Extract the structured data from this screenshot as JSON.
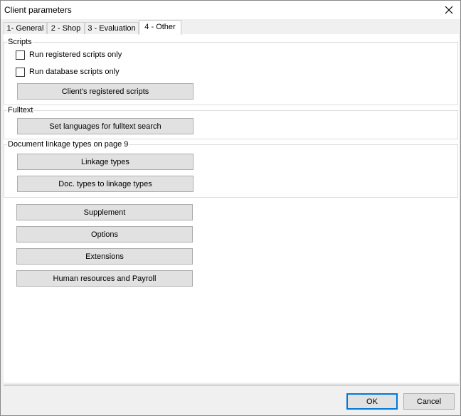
{
  "window": {
    "title": "Client parameters"
  },
  "tabs": [
    {
      "label": "1- General"
    },
    {
      "label": "2 - Shop"
    },
    {
      "label": "3 - Evaluation"
    },
    {
      "label": "4 - Other"
    }
  ],
  "active_tab": "4 - Other",
  "scripts": {
    "label": "Scripts",
    "run_registered_only": {
      "label": "Run registered scripts only",
      "checked": false
    },
    "run_database_only": {
      "label": "Run database scripts only",
      "checked": false
    },
    "registered_scripts_button": "Client's registered scripts"
  },
  "fulltext": {
    "label": "Fulltext",
    "set_languages_button": "Set languages for fulltext search"
  },
  "linkage": {
    "label": "Document linkage types on page 9",
    "linkage_types_button": "Linkage types",
    "doc_types_button": "Doc. types to linkage types"
  },
  "other_buttons": {
    "supplement": "Supplement",
    "options": "Options",
    "extensions": "Extensions",
    "hr_payroll": "Human resources and Payroll"
  },
  "dialog": {
    "ok": "OK",
    "cancel": "Cancel"
  }
}
